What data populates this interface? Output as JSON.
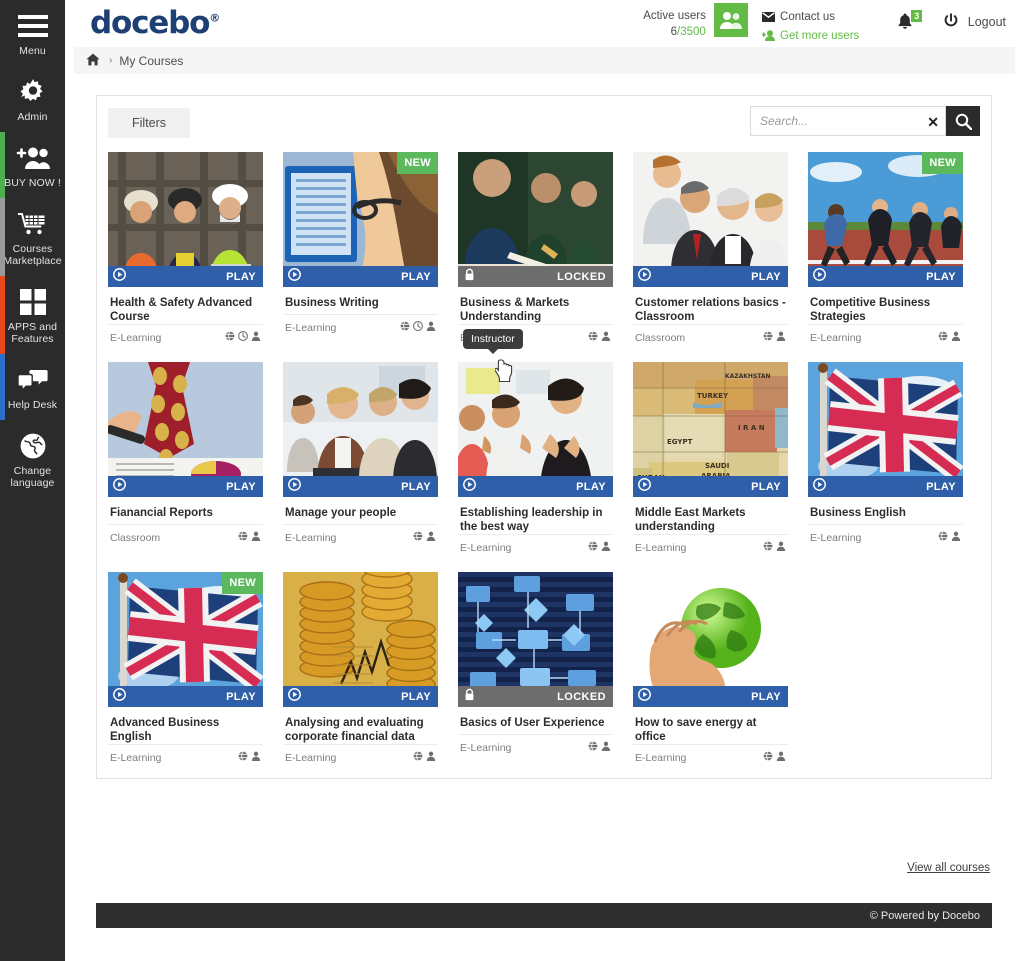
{
  "brand": {
    "logo_text": "docebo",
    "logo_mark": "®",
    "logo_color": "#1e3f74"
  },
  "sidebar": {
    "items": [
      {
        "label": "Menu",
        "icon": "hamburger-icon",
        "accent": ""
      },
      {
        "label": "Admin",
        "icon": "gear-icon",
        "accent": ""
      },
      {
        "label": "BUY NOW !",
        "icon": "add-users-icon",
        "accent": "#4caf50"
      },
      {
        "label": "Courses Marketplace",
        "icon": "cart-icon",
        "accent": "#9a9a9a"
      },
      {
        "label": "APPS and Features",
        "icon": "grid-icon",
        "accent": "#e8491d"
      },
      {
        "label": "Help Desk",
        "icon": "chat-icon",
        "accent": "#2a6fc9"
      },
      {
        "label": "Change language",
        "icon": "globe-icon",
        "accent": ""
      }
    ]
  },
  "header": {
    "active_users_label": "Active users",
    "active_users_used": "6",
    "active_users_separator": "/",
    "active_users_total": "3500",
    "users_icon": "users-icon",
    "contact_us": "Contact us",
    "contact_icon": "envelope-icon",
    "get_more_users": "Get more users",
    "get_more_users_icon": "add-user-icon",
    "notifications_icon": "bell-icon",
    "notifications_count": "3",
    "logout_label": "Logout",
    "logout_icon": "power-icon",
    "accent_green": "#63bb46"
  },
  "breadcrumb": {
    "home_icon": "home-icon",
    "separator": "›",
    "current": "My Courses"
  },
  "toolbar": {
    "filters_label": "Filters",
    "search_placeholder": "Search...",
    "search_value": "",
    "clear_icon": "close-icon",
    "search_icon": "search-icon"
  },
  "tooltip": {
    "text": "Instructor"
  },
  "footer": {
    "view_all_label": "View all courses",
    "copyright": "© Powered by Docebo"
  },
  "labels": {
    "play": "PLAY",
    "locked": "LOCKED",
    "new": "NEW"
  },
  "courses": [
    [
      {
        "title": "Health & Safety Advanced Course",
        "type": "E-Learning",
        "state": "play",
        "new": false,
        "icons": [
          "globe-icon",
          "clock-icon",
          "person-icon"
        ],
        "img": "construction-workers"
      },
      {
        "title": "Business Writing",
        "type": "E-Learning",
        "state": "play",
        "new": true,
        "icons": [
          "globe-icon",
          "clock-icon",
          "person-icon"
        ],
        "img": "woman-tablet"
      },
      {
        "title": "Business & Markets Understanding",
        "type": "E-Learning",
        "state": "locked",
        "new": false,
        "icons": [
          "globe-icon",
          "person-icon"
        ],
        "img": "meeting-notes"
      },
      {
        "title": "Customer relations basics - Classroom",
        "type": "Classroom",
        "state": "play",
        "new": false,
        "icons": [
          "globe-icon",
          "person-icon"
        ],
        "img": "office-trio"
      },
      {
        "title": "Competitive Business Strategies",
        "type": "E-Learning",
        "state": "play",
        "new": true,
        "icons": [
          "globe-icon",
          "person-icon"
        ],
        "img": "race-track"
      }
    ],
    [
      {
        "title": "Fianancial Reports",
        "type": "Classroom",
        "state": "play",
        "new": false,
        "icons": [
          "globe-icon",
          "person-icon"
        ],
        "img": "tie-charts"
      },
      {
        "title": "Manage your people",
        "type": "E-Learning",
        "state": "play",
        "new": false,
        "icons": [
          "globe-icon",
          "person-icon"
        ],
        "img": "team-desk"
      },
      {
        "title": "Establishing leadership in the best way",
        "type": "E-Learning",
        "state": "play",
        "new": false,
        "icons": [
          "globe-icon",
          "person-icon"
        ],
        "img": "applause"
      },
      {
        "title": "Middle East Markets understanding",
        "type": "E-Learning",
        "state": "play",
        "new": false,
        "icons": [
          "globe-icon",
          "person-icon"
        ],
        "img": "middle-east-map"
      },
      {
        "title": "Business English",
        "type": "E-Learning",
        "state": "play",
        "new": false,
        "icons": [
          "globe-icon",
          "person-icon"
        ],
        "img": "uk-flag"
      }
    ],
    [
      {
        "title": "Advanced Business English",
        "type": "E-Learning",
        "state": "play",
        "new": true,
        "icons": [
          "globe-icon",
          "person-icon"
        ],
        "img": "uk-flag"
      },
      {
        "title": "Analysing and evaluating corporate financial data",
        "type": "E-Learning",
        "state": "play",
        "new": false,
        "icons": [
          "globe-icon",
          "person-icon"
        ],
        "img": "gold-coins"
      },
      {
        "title": "Basics of User Experience",
        "type": "E-Learning",
        "state": "locked",
        "new": false,
        "icons": [
          "globe-icon",
          "person-icon"
        ],
        "img": "flowchart"
      },
      {
        "title": "How to save energy at office",
        "type": "E-Learning",
        "state": "play",
        "new": false,
        "icons": [
          "globe-icon",
          "person-icon"
        ],
        "img": "green-globe-hand"
      }
    ]
  ]
}
